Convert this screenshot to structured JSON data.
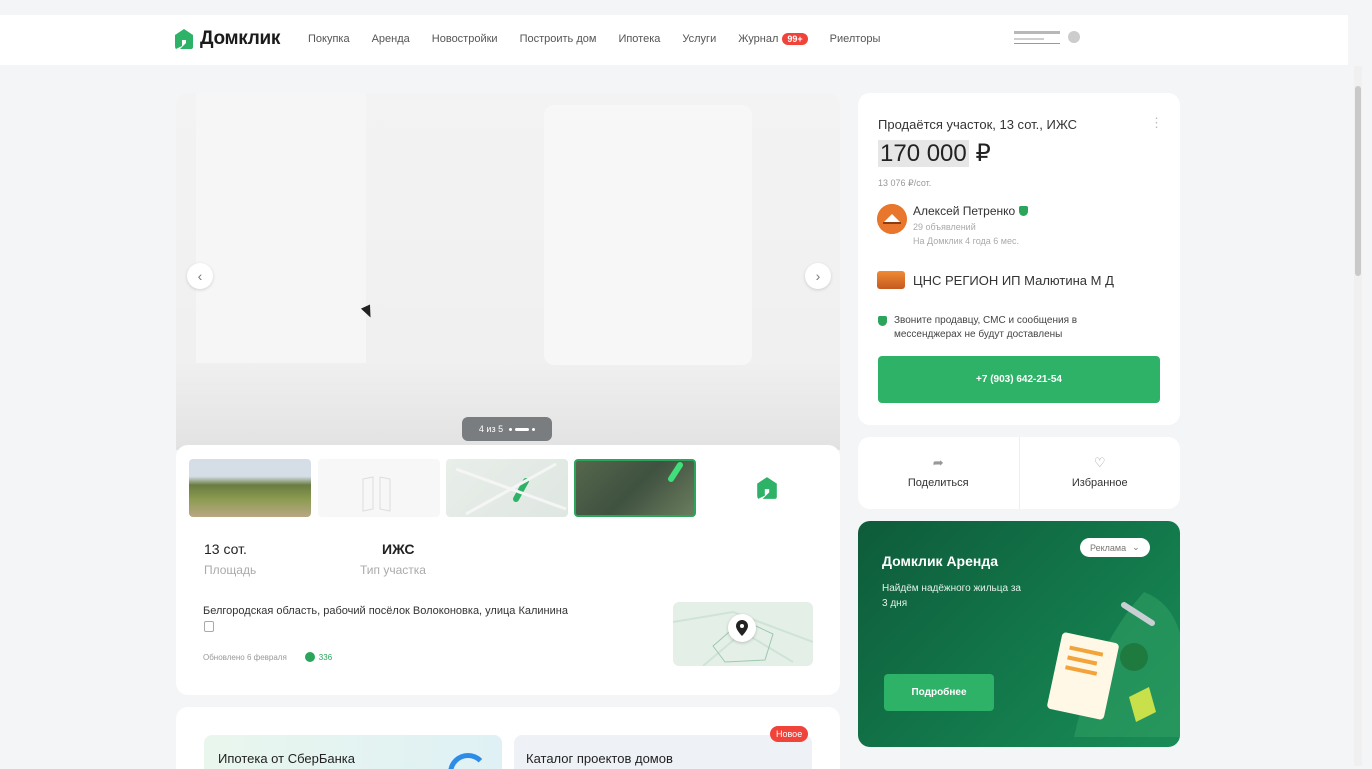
{
  "header": {
    "logo_text": "Домклик",
    "nav": [
      {
        "label": "Покупка"
      },
      {
        "label": "Аренда"
      },
      {
        "label": "Новостройки"
      },
      {
        "label": "Построить дом"
      },
      {
        "label": "Ипотека"
      },
      {
        "label": "Услуги"
      },
      {
        "label": "Журнал",
        "badge": "99+"
      },
      {
        "label": "Риелторы"
      }
    ]
  },
  "gallery": {
    "counter": "4 из 5"
  },
  "listing": {
    "specs": [
      {
        "value": "13 сот.",
        "label": "Площадь"
      },
      {
        "value": "ИЖС",
        "label": "Тип участка"
      }
    ],
    "address": "Белгородская область, рабочий посёлок Волоконовка, улица Калинина",
    "updated": "Обновлено 6 февраля",
    "views": "336"
  },
  "sidebar": {
    "title": "Продаётся участок, 13 сот., ИЖС",
    "price": "170 000",
    "currency": "₽",
    "price_per_unit": "13 076 ₽/сот.",
    "agent": {
      "name": "Алексей Петренко",
      "listings": "29 объявлений",
      "tenure": "На Домклик 4 года 6 мес."
    },
    "agency": "ЦНС РЕГИОН ИП Малютина М Д",
    "notice": "Звоните продавцу, СМС и сообщения в мессенджерах не будут доставлены",
    "phone": "+7 (903) 642-21-54",
    "share_label": "Поделиться",
    "favorite_label": "Избранное"
  },
  "ad": {
    "title": "Домклик Аренда",
    "subtitle": "Найдём надёжного жильца за 3 дня",
    "badge": "Реклама",
    "button": "Подробнее"
  },
  "promos": {
    "mortgage": "Ипотека от СберБанка",
    "catalog": "Каталог проектов домов",
    "new_badge": "Новое"
  },
  "colors": {
    "accent": "#2eb267",
    "badge": "#f0433a",
    "ad_bg": "#137a4c"
  }
}
